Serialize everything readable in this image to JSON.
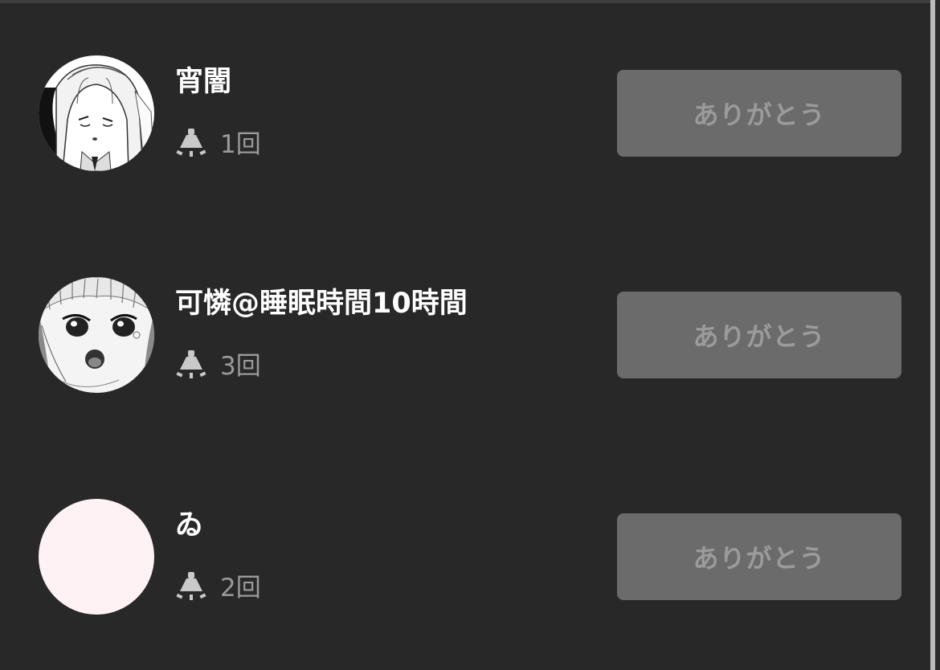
{
  "supporters": [
    {
      "name": "宵闇",
      "count": "1回",
      "icon": "lamp-icon",
      "button_label": "ありがとう",
      "avatar": "manga-girl-long-hair-avatar"
    },
    {
      "name": "可憐@睡眠時間10時間",
      "count": "3回",
      "icon": "lamp-icon",
      "button_label": "ありがとう",
      "avatar": "manga-girl-surprised-avatar"
    },
    {
      "name": "ゐ",
      "count": "2回",
      "icon": "lamp-icon",
      "button_label": "ありがとう",
      "avatar": "pink-blank-avatar"
    }
  ],
  "colors": {
    "background": "#282828",
    "name_text": "#ffffff",
    "count_text": "#9a9a9a",
    "button_bg": "#6b6b6b",
    "button_text": "#9b9b9b",
    "blank_avatar": "#fff2f5"
  }
}
